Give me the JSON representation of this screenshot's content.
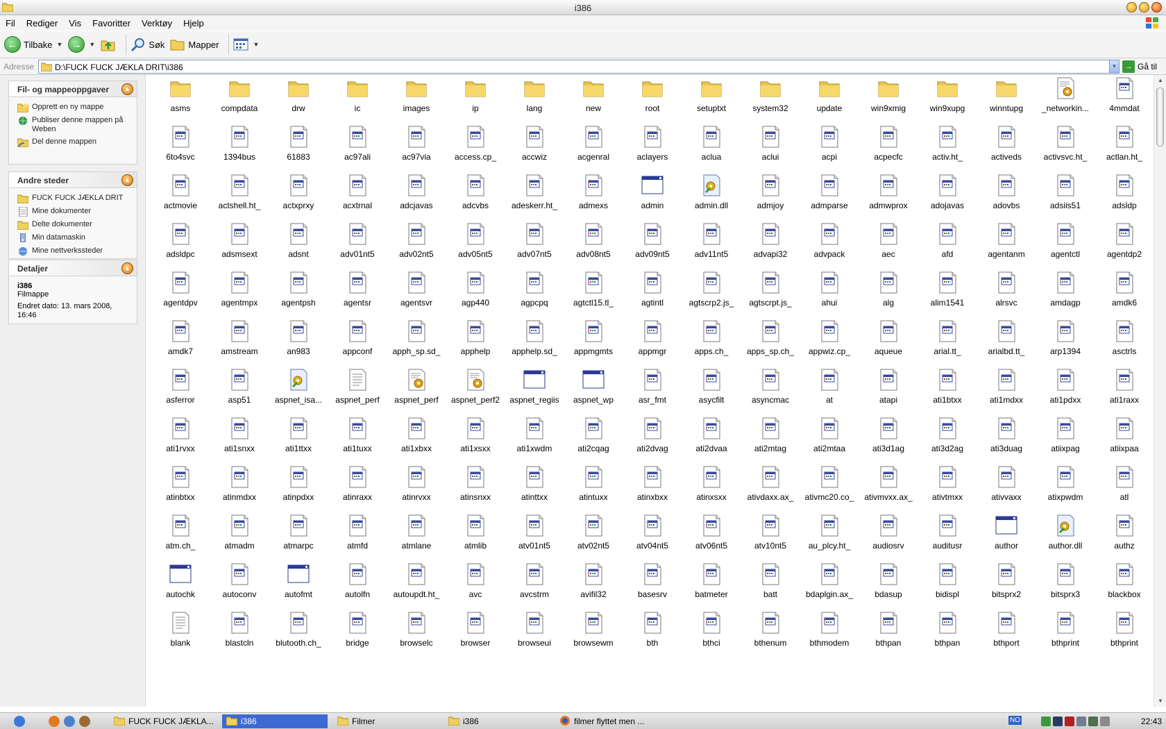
{
  "window": {
    "title": "i386"
  },
  "menu": [
    "Fil",
    "Rediger",
    "Vis",
    "Favoritter",
    "Verktøy",
    "Hjelp"
  ],
  "toolbar": {
    "back": "Tilbake",
    "search": "Søk",
    "folders": "Mapper"
  },
  "address": {
    "label": "Adresse",
    "path": "D:\\FUCK FUCK JÆKLA DRIT\\i386",
    "go": "Gå til"
  },
  "tasks": {
    "title": "Fil- og mappeoppgaver",
    "items": [
      "Opprett en ny mappe",
      "Publiser denne mappen på Weben",
      "Del denne mappen"
    ]
  },
  "places": {
    "title": "Andre steder",
    "items": [
      "FUCK FUCK JÆKLA DRIT",
      "Mine dokumenter",
      "Delte dokumenter",
      "Min datamaskin",
      "Mine nettverkssteder"
    ]
  },
  "details": {
    "title": "Detaljer",
    "name": "i386",
    "type": "Filmappe",
    "modified": "Endret dato: 13. mars 2008, 16:46"
  },
  "files": [
    {
      "n": "asms",
      "t": "folder"
    },
    {
      "n": "compdata",
      "t": "folder"
    },
    {
      "n": "drw",
      "t": "folder"
    },
    {
      "n": "ic",
      "t": "folder"
    },
    {
      "n": "images",
      "t": "folder"
    },
    {
      "n": "ip",
      "t": "folder"
    },
    {
      "n": "lang",
      "t": "folder"
    },
    {
      "n": "new",
      "t": "folder"
    },
    {
      "n": "root",
      "t": "folder"
    },
    {
      "n": "setuptxt",
      "t": "folder"
    },
    {
      "n": "system32",
      "t": "folder"
    },
    {
      "n": "update",
      "t": "folder"
    },
    {
      "n": "win9xmig",
      "t": "folder"
    },
    {
      "n": "win9xupg",
      "t": "folder"
    },
    {
      "n": "winntupg",
      "t": "folder"
    },
    {
      "n": "_networkin...",
      "t": "config"
    },
    {
      "n": "4mmdat",
      "t": "file"
    },
    {
      "n": "6to4svc",
      "t": "file"
    },
    {
      "n": "1394bus",
      "t": "file"
    },
    {
      "n": "61883",
      "t": "file"
    },
    {
      "n": "ac97ali",
      "t": "file"
    },
    {
      "n": "ac97via",
      "t": "file"
    },
    {
      "n": "access.cp_",
      "t": "file"
    },
    {
      "n": "accwiz",
      "t": "file"
    },
    {
      "n": "acgenral",
      "t": "file"
    },
    {
      "n": "aclayers",
      "t": "file"
    },
    {
      "n": "aclua",
      "t": "file"
    },
    {
      "n": "aclui",
      "t": "file"
    },
    {
      "n": "acpi",
      "t": "file"
    },
    {
      "n": "acpecfc",
      "t": "file"
    },
    {
      "n": "activ.ht_",
      "t": "file"
    },
    {
      "n": "activeds",
      "t": "file"
    },
    {
      "n": "activsvc.ht_",
      "t": "file"
    },
    {
      "n": "actlan.ht_",
      "t": "file"
    },
    {
      "n": "actmovie",
      "t": "file"
    },
    {
      "n": "actshell.ht_",
      "t": "file"
    },
    {
      "n": "actxprxy",
      "t": "file"
    },
    {
      "n": "acxtrnal",
      "t": "file"
    },
    {
      "n": "adcjavas",
      "t": "file"
    },
    {
      "n": "adcvbs",
      "t": "file"
    },
    {
      "n": "adeskerr.ht_",
      "t": "file"
    },
    {
      "n": "admexs",
      "t": "file"
    },
    {
      "n": "admin",
      "t": "app"
    },
    {
      "n": "admin.dll",
      "t": "dll"
    },
    {
      "n": "admjoy",
      "t": "file"
    },
    {
      "n": "admparse",
      "t": "file"
    },
    {
      "n": "admwprox",
      "t": "file"
    },
    {
      "n": "adojavas",
      "t": "file"
    },
    {
      "n": "adovbs",
      "t": "file"
    },
    {
      "n": "adsiis51",
      "t": "file"
    },
    {
      "n": "adsldp",
      "t": "file"
    },
    {
      "n": "adsldpc",
      "t": "file"
    },
    {
      "n": "adsmsext",
      "t": "file"
    },
    {
      "n": "adsnt",
      "t": "file"
    },
    {
      "n": "adv01nt5",
      "t": "file"
    },
    {
      "n": "adv02nt5",
      "t": "file"
    },
    {
      "n": "adv05nt5",
      "t": "file"
    },
    {
      "n": "adv07nt5",
      "t": "file"
    },
    {
      "n": "adv08nt5",
      "t": "file"
    },
    {
      "n": "adv09nt5",
      "t": "file"
    },
    {
      "n": "adv11nt5",
      "t": "file"
    },
    {
      "n": "advapi32",
      "t": "file"
    },
    {
      "n": "advpack",
      "t": "file"
    },
    {
      "n": "aec",
      "t": "file"
    },
    {
      "n": "afd",
      "t": "file"
    },
    {
      "n": "agentanm",
      "t": "file"
    },
    {
      "n": "agentctl",
      "t": "file"
    },
    {
      "n": "agentdp2",
      "t": "file"
    },
    {
      "n": "agentdpv",
      "t": "file"
    },
    {
      "n": "agentmpx",
      "t": "file"
    },
    {
      "n": "agentpsh",
      "t": "file"
    },
    {
      "n": "agentsr",
      "t": "file"
    },
    {
      "n": "agentsvr",
      "t": "file"
    },
    {
      "n": "agp440",
      "t": "file"
    },
    {
      "n": "agpcpq",
      "t": "file"
    },
    {
      "n": "agtctl15.tl_",
      "t": "file"
    },
    {
      "n": "agtintl",
      "t": "file"
    },
    {
      "n": "agtscrp2.js_",
      "t": "file"
    },
    {
      "n": "agtscrpt.js_",
      "t": "file"
    },
    {
      "n": "ahui",
      "t": "file"
    },
    {
      "n": "alg",
      "t": "file"
    },
    {
      "n": "alim1541",
      "t": "file"
    },
    {
      "n": "alrsvc",
      "t": "file"
    },
    {
      "n": "amdagp",
      "t": "file"
    },
    {
      "n": "amdk6",
      "t": "file"
    },
    {
      "n": "amdk7",
      "t": "file"
    },
    {
      "n": "amstream",
      "t": "file"
    },
    {
      "n": "an983",
      "t": "file"
    },
    {
      "n": "appconf",
      "t": "file"
    },
    {
      "n": "apph_sp.sd_",
      "t": "file"
    },
    {
      "n": "apphelp",
      "t": "file"
    },
    {
      "n": "apphelp.sd_",
      "t": "file"
    },
    {
      "n": "appmgmts",
      "t": "file"
    },
    {
      "n": "appmgr",
      "t": "file"
    },
    {
      "n": "apps.ch_",
      "t": "file"
    },
    {
      "n": "apps_sp.ch_",
      "t": "file"
    },
    {
      "n": "appwiz.cp_",
      "t": "file"
    },
    {
      "n": "aqueue",
      "t": "file"
    },
    {
      "n": "arial.tt_",
      "t": "file"
    },
    {
      "n": "arialbd.tt_",
      "t": "file"
    },
    {
      "n": "arp1394",
      "t": "file"
    },
    {
      "n": "asctrls",
      "t": "file"
    },
    {
      "n": "asferror",
      "t": "file"
    },
    {
      "n": "asp51",
      "t": "file"
    },
    {
      "n": "aspnet_isa...",
      "t": "dll"
    },
    {
      "n": "aspnet_perf",
      "t": "text"
    },
    {
      "n": "aspnet_perf",
      "t": "config"
    },
    {
      "n": "aspnet_perf2",
      "t": "config"
    },
    {
      "n": "aspnet_regiis",
      "t": "app"
    },
    {
      "n": "aspnet_wp",
      "t": "app"
    },
    {
      "n": "asr_fmt",
      "t": "file"
    },
    {
      "n": "asycfilt",
      "t": "file"
    },
    {
      "n": "asyncmac",
      "t": "file"
    },
    {
      "n": "at",
      "t": "file"
    },
    {
      "n": "atapi",
      "t": "file"
    },
    {
      "n": "ati1btxx",
      "t": "file"
    },
    {
      "n": "ati1mdxx",
      "t": "file"
    },
    {
      "n": "ati1pdxx",
      "t": "file"
    },
    {
      "n": "ati1raxx",
      "t": "file"
    },
    {
      "n": "ati1rvxx",
      "t": "file"
    },
    {
      "n": "ati1snxx",
      "t": "file"
    },
    {
      "n": "ati1ttxx",
      "t": "file"
    },
    {
      "n": "ati1tuxx",
      "t": "file"
    },
    {
      "n": "ati1xbxx",
      "t": "file"
    },
    {
      "n": "ati1xsxx",
      "t": "file"
    },
    {
      "n": "ati1xwdm",
      "t": "file"
    },
    {
      "n": "ati2cqag",
      "t": "file"
    },
    {
      "n": "ati2dvag",
      "t": "file"
    },
    {
      "n": "ati2dvaa",
      "t": "file"
    },
    {
      "n": "ati2mtag",
      "t": "file"
    },
    {
      "n": "ati2mtaa",
      "t": "file"
    },
    {
      "n": "ati3d1ag",
      "t": "file"
    },
    {
      "n": "ati3d2ag",
      "t": "file"
    },
    {
      "n": "ati3duag",
      "t": "file"
    },
    {
      "n": "atiixpag",
      "t": "file"
    },
    {
      "n": "atiixpaa",
      "t": "file"
    },
    {
      "n": "atinbtxx",
      "t": "file"
    },
    {
      "n": "atinmdxx",
      "t": "file"
    },
    {
      "n": "atinpdxx",
      "t": "file"
    },
    {
      "n": "atinraxx",
      "t": "file"
    },
    {
      "n": "atinrvxx",
      "t": "file"
    },
    {
      "n": "atinsnxx",
      "t": "file"
    },
    {
      "n": "atinttxx",
      "t": "file"
    },
    {
      "n": "atintuxx",
      "t": "file"
    },
    {
      "n": "atinxbxx",
      "t": "file"
    },
    {
      "n": "atinxsxx",
      "t": "file"
    },
    {
      "n": "ativdaxx.ax_",
      "t": "file"
    },
    {
      "n": "ativmc20.co_",
      "t": "file"
    },
    {
      "n": "ativmvxx.ax_",
      "t": "file"
    },
    {
      "n": "ativtmxx",
      "t": "file"
    },
    {
      "n": "ativvaxx",
      "t": "file"
    },
    {
      "n": "atixpwdm",
      "t": "file"
    },
    {
      "n": "atl",
      "t": "file"
    },
    {
      "n": "atm.ch_",
      "t": "file"
    },
    {
      "n": "atmadm",
      "t": "file"
    },
    {
      "n": "atmarpc",
      "t": "file"
    },
    {
      "n": "atmfd",
      "t": "file"
    },
    {
      "n": "atmlane",
      "t": "file"
    },
    {
      "n": "atmlib",
      "t": "file"
    },
    {
      "n": "atv01nt5",
      "t": "file"
    },
    {
      "n": "atv02nt5",
      "t": "file"
    },
    {
      "n": "atv04nt5",
      "t": "file"
    },
    {
      "n": "atv06nt5",
      "t": "file"
    },
    {
      "n": "atv10nt5",
      "t": "file"
    },
    {
      "n": "au_plcy.ht_",
      "t": "file"
    },
    {
      "n": "audiosrv",
      "t": "file"
    },
    {
      "n": "auditusr",
      "t": "file"
    },
    {
      "n": "author",
      "t": "app"
    },
    {
      "n": "author.dll",
      "t": "dll"
    },
    {
      "n": "authz",
      "t": "file"
    },
    {
      "n": "autochk",
      "t": "app"
    },
    {
      "n": "autoconv",
      "t": "file"
    },
    {
      "n": "autofmt",
      "t": "app"
    },
    {
      "n": "autolfn",
      "t": "file"
    },
    {
      "n": "autoupdt.ht_",
      "t": "file"
    },
    {
      "n": "avc",
      "t": "file"
    },
    {
      "n": "avcstrm",
      "t": "file"
    },
    {
      "n": "avifil32",
      "t": "file"
    },
    {
      "n": "basesrv",
      "t": "file"
    },
    {
      "n": "batmeter",
      "t": "file"
    },
    {
      "n": "batt",
      "t": "file"
    },
    {
      "n": "bdaplgin.ax_",
      "t": "file"
    },
    {
      "n": "bdasup",
      "t": "file"
    },
    {
      "n": "bidispl",
      "t": "file"
    },
    {
      "n": "bitsprx2",
      "t": "file"
    },
    {
      "n": "bitsprx3",
      "t": "file"
    },
    {
      "n": "blackbox",
      "t": "file"
    },
    {
      "n": "blank",
      "t": "text"
    },
    {
      "n": "blastcln",
      "t": "file"
    },
    {
      "n": "blutooth.ch_",
      "t": "file"
    },
    {
      "n": "bridge",
      "t": "file"
    },
    {
      "n": "browselc",
      "t": "file"
    },
    {
      "n": "browser",
      "t": "file"
    },
    {
      "n": "browseui",
      "t": "file"
    },
    {
      "n": "browsewm",
      "t": "file"
    },
    {
      "n": "bth",
      "t": "file"
    },
    {
      "n": "bthci",
      "t": "file"
    },
    {
      "n": "bthenum",
      "t": "file"
    },
    {
      "n": "bthmodem",
      "t": "file"
    },
    {
      "n": "bthpan",
      "t": "file"
    },
    {
      "n": "bthpan",
      "t": "file"
    },
    {
      "n": "bthport",
      "t": "file"
    },
    {
      "n": "bthprint",
      "t": "file"
    },
    {
      "n": "bthprint",
      "t": "file"
    }
  ],
  "taskbar": {
    "buttons": [
      {
        "label": "FUCK FUCK JÆKLA...",
        "icon": "folder",
        "active": false
      },
      {
        "label": "i386",
        "icon": "folder",
        "active": true
      },
      {
        "label": "Filmer",
        "icon": "folder",
        "active": false
      },
      {
        "label": "i386",
        "icon": "folder",
        "active": false
      },
      {
        "label": "filmer flyttet men ...",
        "icon": "firefox",
        "active": false
      }
    ],
    "tray_badge": "NO",
    "clock": "22:43"
  }
}
